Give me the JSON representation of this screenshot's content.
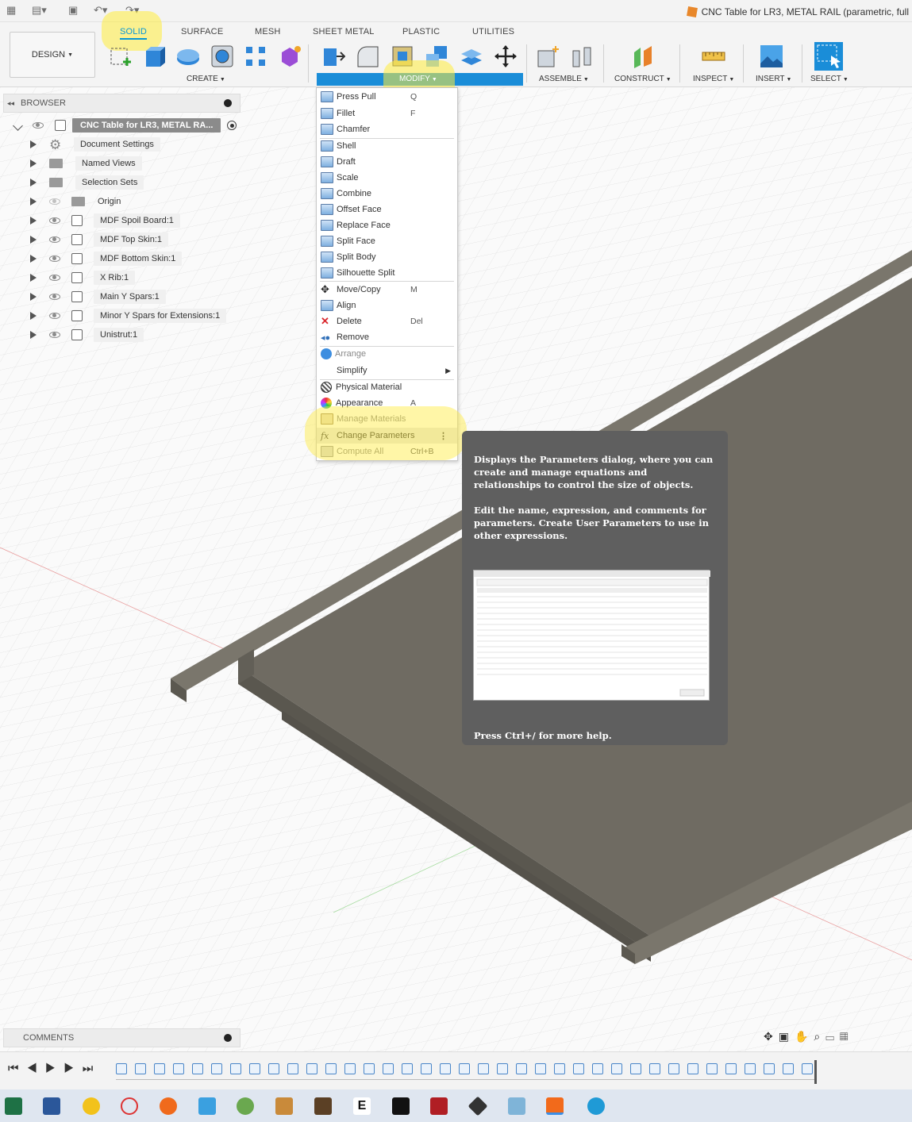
{
  "title_bar": {
    "document_title": "CNC Table for LR3, METAL RAIL (parametric, full"
  },
  "toolbar": {
    "workspace_button": "DESIGN",
    "tabs": [
      "SOLID",
      "SURFACE",
      "MESH",
      "SHEET METAL",
      "PLASTIC",
      "UTILITIES"
    ],
    "active_tab": "SOLID",
    "groups": [
      "CREATE",
      "MODIFY",
      "ASSEMBLE",
      "CONSTRUCT",
      "INSPECT",
      "INSERT",
      "SELECT"
    ]
  },
  "browser": {
    "header": "BROWSER",
    "root": "CNC Table for LR3, METAL RA...",
    "nodes": [
      "Document Settings",
      "Named Views",
      "Selection Sets",
      "Origin",
      "MDF Spoil Board:1",
      "MDF Top Skin:1",
      "MDF Bottom Skin:1",
      "X Rib:1",
      "Main Y Spars:1",
      "Minor Y Spars for Extensions:1",
      "Unistrut:1"
    ]
  },
  "modify_menu": {
    "items": [
      {
        "label": "Press Pull",
        "shortcut": "Q"
      },
      {
        "label": "Fillet",
        "shortcut": "F"
      },
      {
        "label": "Chamfer",
        "shortcut": ""
      },
      {
        "label": "Shell",
        "shortcut": ""
      },
      {
        "label": "Draft",
        "shortcut": ""
      },
      {
        "label": "Scale",
        "shortcut": ""
      },
      {
        "label": "Combine",
        "shortcut": ""
      },
      {
        "label": "Offset Face",
        "shortcut": ""
      },
      {
        "label": "Replace Face",
        "shortcut": ""
      },
      {
        "label": "Split Face",
        "shortcut": ""
      },
      {
        "label": "Split Body",
        "shortcut": ""
      },
      {
        "label": "Silhouette Split",
        "shortcut": ""
      },
      {
        "label": "Move/Copy",
        "shortcut": "M"
      },
      {
        "label": "Align",
        "shortcut": ""
      },
      {
        "label": "Delete",
        "shortcut": "Del"
      },
      {
        "label": "Remove",
        "shortcut": ""
      },
      {
        "label": "Arrange",
        "shortcut": ""
      },
      {
        "label": "Simplify",
        "shortcut": ""
      },
      {
        "label": "Physical Material",
        "shortcut": ""
      },
      {
        "label": "Appearance",
        "shortcut": "A"
      },
      {
        "label": "Manage Materials",
        "shortcut": ""
      },
      {
        "label": "Change Parameters",
        "shortcut": ""
      },
      {
        "label": "Compute All",
        "shortcut": "Ctrl+B"
      }
    ]
  },
  "tooltip": {
    "paragraph1": "Displays the Parameters dialog, where you can create and manage equations and relationships to control the size of objects.",
    "paragraph2": "Edit the name, expression, and comments for parameters. Create User Parameters to use in other expressions.",
    "help": "Press Ctrl+/ for more help."
  },
  "comments": {
    "header": "COMMENTS"
  },
  "colors": {
    "accent": "#0696d7",
    "modify_bar": "#1a8dd8",
    "highlight": "#ffec3c",
    "model": "#6e6a60",
    "tooltip_bg": "#5f5f5f"
  }
}
